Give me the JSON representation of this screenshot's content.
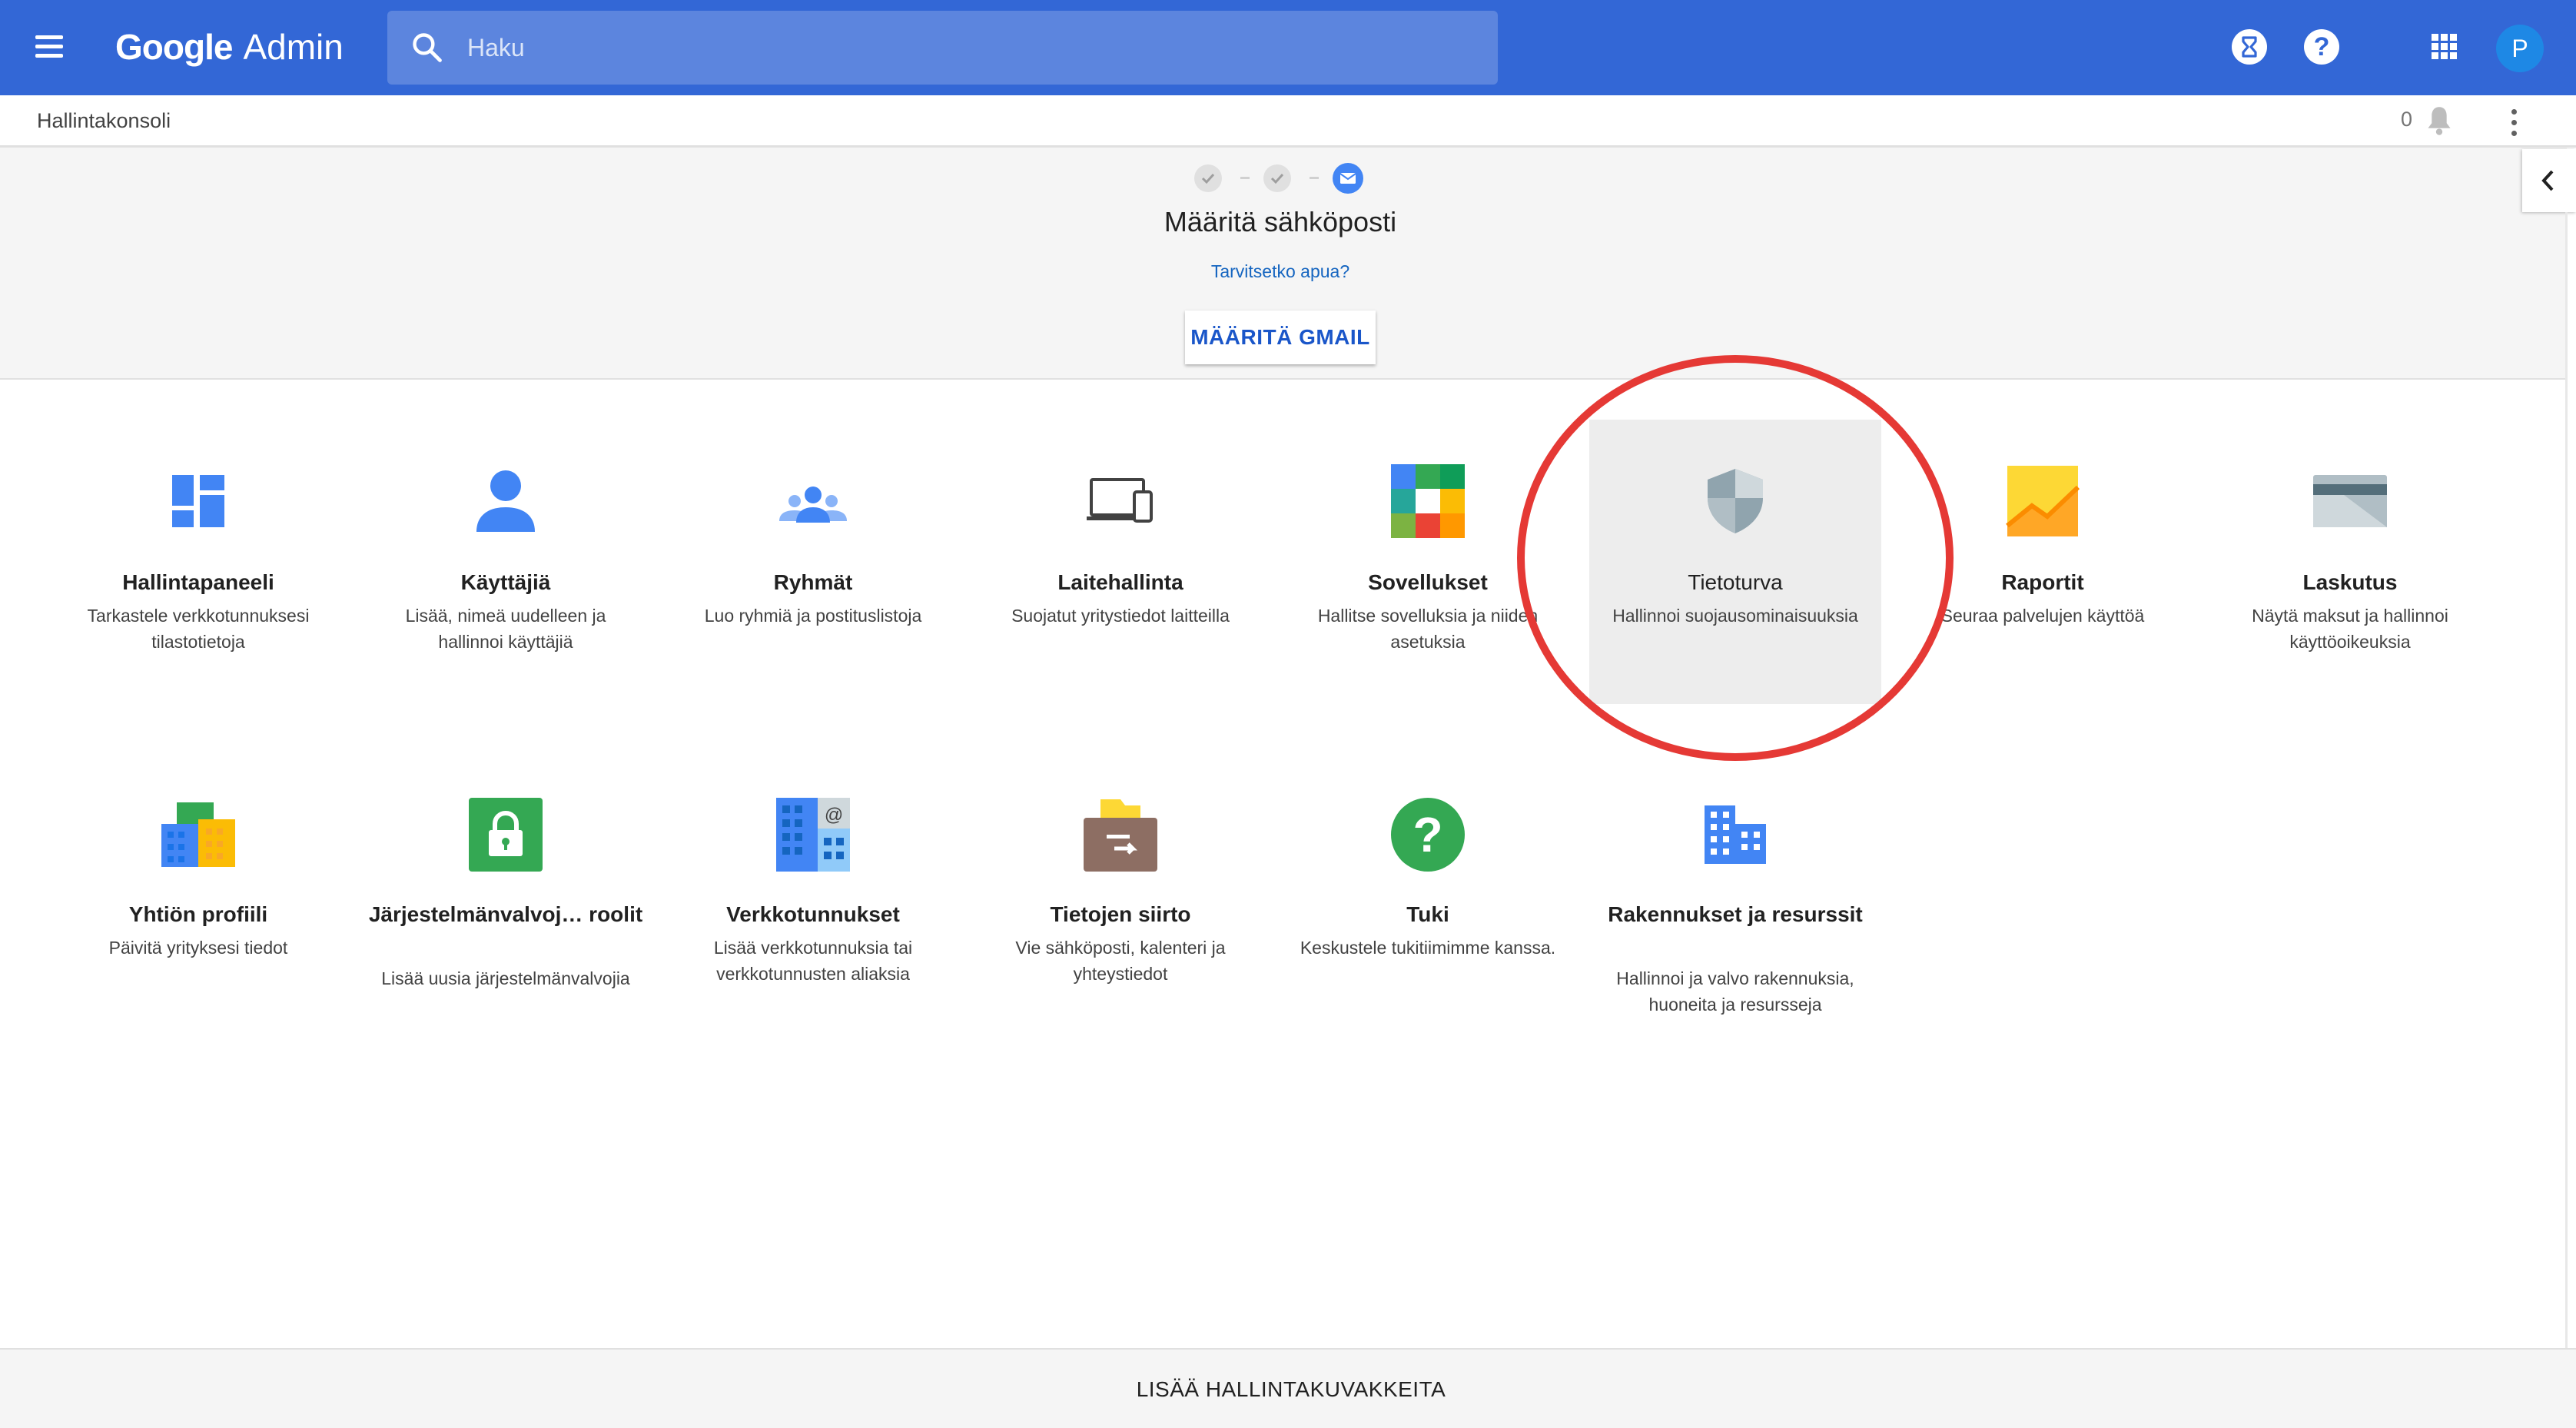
{
  "header": {
    "logo_google": "Google",
    "logo_admin": "Admin",
    "search_placeholder": "Haku",
    "avatar_letter": "P",
    "help_glyph": "?"
  },
  "subbar": {
    "breadcrumb": "Hallintakonsoli",
    "notification_count": "0"
  },
  "setup": {
    "title": "Määritä sähköposti",
    "help_link": "Tarvitsetko apua?",
    "button_label": "MÄÄRITÄ GMAIL"
  },
  "tiles": [
    {
      "title": "Hallintapaneeli",
      "desc": "Tarkastele verkkotunnuksesi tilastotietoja",
      "icon": "dashboard-icon"
    },
    {
      "title": "Käyttäjiä",
      "desc": "Lisää, nimeä uudelleen ja hallinnoi käyttäjiä",
      "icon": "user-icon"
    },
    {
      "title": "Ryhmät",
      "desc": "Luo ryhmiä ja postituslistoja",
      "icon": "groups-icon"
    },
    {
      "title": "Laitehallinta",
      "desc": "Suojatut yritystiedot laitteilla",
      "icon": "devices-icon"
    },
    {
      "title": "Sovellukset",
      "desc": "Hallitse sovelluksia ja niiden asetuksia",
      "icon": "apps-icon"
    },
    {
      "title": "Tietoturva",
      "desc": "Hallinnoi suojausominaisuuksia",
      "icon": "shield-icon"
    },
    {
      "title": "Raportit",
      "desc": "Seuraa palvelujen käyttöä",
      "icon": "reports-chart-icon"
    },
    {
      "title": "Laskutus",
      "desc": "Näytä maksut ja hallinnoi käyttöoikeuksia",
      "icon": "credit-card-icon"
    },
    {
      "title": "Yhtiön profiili",
      "desc": "Päivitä yrityksesi tiedot",
      "icon": "company-buildings-icon"
    },
    {
      "title": "Järjestelmänvalvoj… roolit",
      "desc": "Lisää uusia järjestelmänvalvojia",
      "icon": "lock-icon"
    },
    {
      "title": "Verkkotunnukset",
      "desc": "Lisää verkkotunnuksia tai verkkotunnusten aliaksia",
      "icon": "domains-icon"
    },
    {
      "title": "Tietojen siirto",
      "desc": "Vie sähköposti, kalenteri ja yhteystiedot",
      "icon": "data-migration-icon"
    },
    {
      "title": "Tuki",
      "desc": "Keskustele tukitiimimme kanssa.",
      "icon": "support-question-icon"
    },
    {
      "title": "Rakennukset ja resurssit",
      "desc": "Hallinnoi ja valvo rakennuksia, huoneita ja resursseja",
      "icon": "building-icon"
    }
  ],
  "footer": {
    "add_tiles_label": "LISÄÄ HALLINTAKUVAKKEITA"
  },
  "colors": {
    "header_blue": "#3367d6",
    "search_bg": "#5c85de",
    "annotation_red": "#e53935",
    "highlight_bg": "#ededed"
  }
}
